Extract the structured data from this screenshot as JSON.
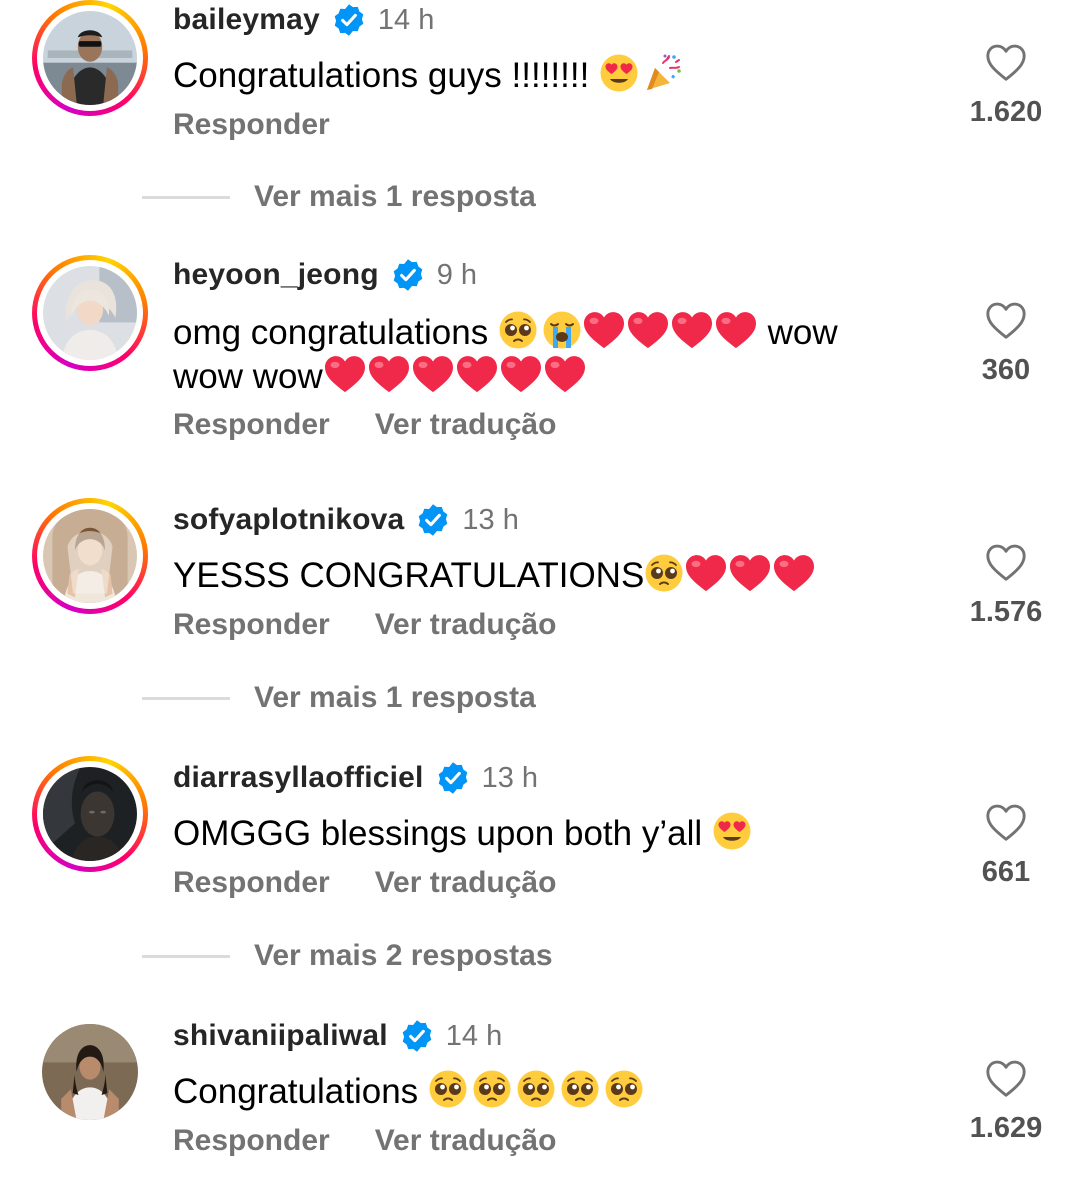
{
  "comments": [
    {
      "username": "baileymay",
      "time": "14 h",
      "text": "Congratulations guys !!!!!!!! ",
      "emojis": [
        "heart-eyes-emoji",
        "party-popper-emoji"
      ],
      "reply_label": "Responder",
      "translate_label": "",
      "likes": "1.620",
      "more_replies": "Ver mais 1 resposta"
    },
    {
      "username": "heyoon_jeong",
      "time": "9 h",
      "text_a": "omg congratulations ",
      "text_b": " wow",
      "text_c": "wow wow",
      "emojis": [
        "pleading-face-emoji",
        "crying-face-emoji",
        "red-heart-emoji"
      ],
      "reply_label": "Responder",
      "translate_label": "Ver tradução",
      "likes": "360"
    },
    {
      "username": "sofyaplotnikova",
      "time": "13 h",
      "text": "YESSS CONGRATULATIONS",
      "emojis": [
        "pleading-face-emoji",
        "red-heart-emoji"
      ],
      "reply_label": "Responder",
      "translate_label": "Ver tradução",
      "likes": "1.576",
      "more_replies": "Ver mais 1 resposta"
    },
    {
      "username": "diarrasyllaofficiel",
      "time": "13 h",
      "text": "OMGGG blessings upon both y’all ",
      "emojis": [
        "heart-eyes-emoji"
      ],
      "reply_label": "Responder",
      "translate_label": "Ver tradução",
      "likes": "661",
      "more_replies": "Ver mais 2 respostas"
    },
    {
      "username": "shivaniipaliwal",
      "time": "14 h",
      "text": "Congratulations ",
      "emojis": [
        "pleading-face-emoji"
      ],
      "reply_label": "Responder",
      "translate_label": "Ver tradução",
      "likes": "1.629"
    }
  ],
  "colors": {
    "username": "#262626",
    "muted": "#737373",
    "verified": "#0095f6",
    "heart_emoji": "#f02849",
    "story_ring": [
      "#d300c5",
      "#ff0069",
      "#ff7a00",
      "#ffd600"
    ]
  },
  "icons": {
    "like": "heart-outline-icon",
    "verified": "verified-badge-icon"
  }
}
